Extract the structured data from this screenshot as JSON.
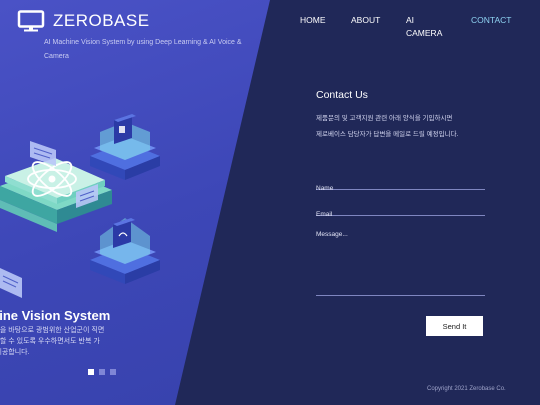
{
  "header": {
    "logo_text": "ZEROBASE",
    "logo_icon": "monitor-icon",
    "tagline": "AI Machine Vision System by using Deep Learning & AI Voice & Camera"
  },
  "nav": {
    "items": [
      {
        "label": "HOME",
        "active": false
      },
      {
        "label": "ABOUT",
        "active": false
      },
      {
        "label": "AI CAMERA",
        "active": false
      },
      {
        "label": "CONTACT",
        "active": true
      }
    ]
  },
  "hero": {
    "title": "Machine Vision System",
    "description_lines": [
      "기술을 바탕으로 광범위한 산업군이 직면",
      "대결할 수 있도록 우수하면서도 반복 가",
      "를 제공합니다."
    ],
    "slider_dots": 3,
    "active_dot": 1
  },
  "contact": {
    "title": "Contact Us",
    "description_lines": [
      "제품문의 및 고객지원 관련 아래 양식을 기입하시면",
      "제로베이스 담당자가 답변을 메일로 드릴 예정입니다."
    ],
    "name_placeholder": "Name",
    "email_placeholder": "Email",
    "message_placeholder": "Message...",
    "send_label": "Send It"
  },
  "footer": {
    "copyright": "Copyright 2021 Zerobase Co."
  },
  "colors": {
    "left_panel": "#3d47b7",
    "right_panel": "#202858",
    "nav_active": "#8fd3f2",
    "button_bg": "#ffffff"
  }
}
